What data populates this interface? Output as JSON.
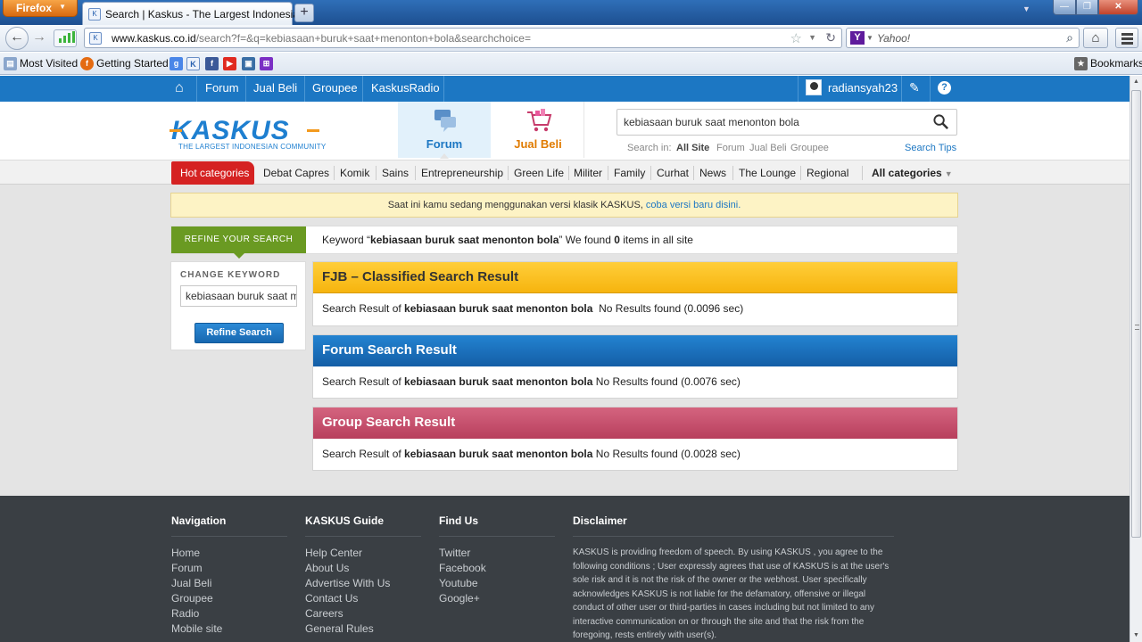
{
  "browser": {
    "app_button": "Firefox",
    "tab_title": "Search | Kaskus - The Largest Indonesian...",
    "url_domain": "www.kaskus.co.id",
    "url_path": "/search?f=&q=kebiasaan+buruk+saat+menonton+bola&searchchoice=",
    "search_placeholder": "Yahoo!",
    "bookmarks": {
      "most_visited": "Most Visited",
      "getting_started": "Getting Started",
      "bookmarks_menu": "Bookmarks"
    }
  },
  "site": {
    "topnav": {
      "links": [
        "Forum",
        "Jual Beli",
        "Groupee",
        "KaskusRadio"
      ],
      "username": "radiansyah23"
    },
    "logo": {
      "word": "KASKUS",
      "tagline": "THE LARGEST INDONESIAN COMMUNITY"
    },
    "header_tabs": {
      "forum": "Forum",
      "jual_beli": "Jual Beli"
    },
    "search": {
      "value": "kebiasaan buruk saat menonton bola",
      "search_in_label": "Search in:",
      "scopes": [
        "All Site",
        "Forum",
        "Jual Beli",
        "Groupee"
      ],
      "tips": "Search Tips"
    },
    "categories": {
      "hot": "Hot categories",
      "items": [
        "Debat Capres",
        "Komik",
        "Sains",
        "Entrepreneurship",
        "Green Life",
        "Militer",
        "Family",
        "Curhat",
        "News",
        "The Lounge",
        "Regional"
      ],
      "all": "All categories"
    },
    "notice": {
      "text": "Saat ini kamu sedang menggunakan versi klasik KASKUS,",
      "link": "coba versi baru disini."
    },
    "refine": {
      "tab_label": "REFINE YOUR SEARCH",
      "keyword_prefix": "Keyword “",
      "keyword": "kebiasaan buruk saat menonton bola",
      "keyword_mid": "” We found ",
      "count": "0",
      "keyword_suffix": " items in all site"
    },
    "sidebar": {
      "heading": "CHANGE KEYWORD",
      "input_value": "kebiasaan buruk saat menonton bola",
      "button": "Refine Search"
    },
    "results": [
      {
        "title": "FJB – Classified Search Result",
        "prefix": "Search Result of ",
        "keyword": "kebiasaan buruk saat menonton bola",
        "status": "  No Results found (0.0096 sec)"
      },
      {
        "title": "Forum Search Result",
        "prefix": "Search Result of ",
        "keyword": "kebiasaan buruk saat menonton bola",
        "status": " No Results found (0.0076 sec)"
      },
      {
        "title": "Group Search Result",
        "prefix": "Search Result of ",
        "keyword": "kebiasaan buruk saat menonton bola",
        "status": " No Results found (0.0028 sec)"
      }
    ],
    "footer": {
      "navigation": {
        "heading": "Navigation",
        "links": [
          "Home",
          "Forum",
          "Jual Beli",
          "Groupee",
          "Radio",
          "Mobile site"
        ]
      },
      "guide": {
        "heading": "KASKUS Guide",
        "links": [
          "Help Center",
          "About Us",
          "Advertise With Us",
          "Contact Us",
          "Careers",
          "General Rules"
        ]
      },
      "find_us": {
        "heading": "Find Us",
        "links": [
          "Twitter",
          "Facebook",
          "Youtube",
          "Google+"
        ]
      },
      "disclaimer": {
        "heading": "Disclaimer",
        "text": "KASKUS is providing freedom of speech. By using KASKUS , you agree to the following conditions ; User expressly agrees that use of KASKUS is at the user's sole risk and it is not the risk of the owner or the webhost. User specifically acknowledges KASKUS is not liable for the defamatory, offensive or illegal conduct of other user or third-parties in cases including but not limited to any interactive communication on or through the site and that the risk from the foregoing, rests entirely with user(s)."
      }
    }
  },
  "colors": {
    "brand_blue": "#1c77c3",
    "hot_red": "#d52222",
    "refine_green": "#6a9a22",
    "fjb_yellow": "#f6b40e",
    "group_pink": "#b83f5d",
    "footer_bg": "#3a3f44"
  }
}
